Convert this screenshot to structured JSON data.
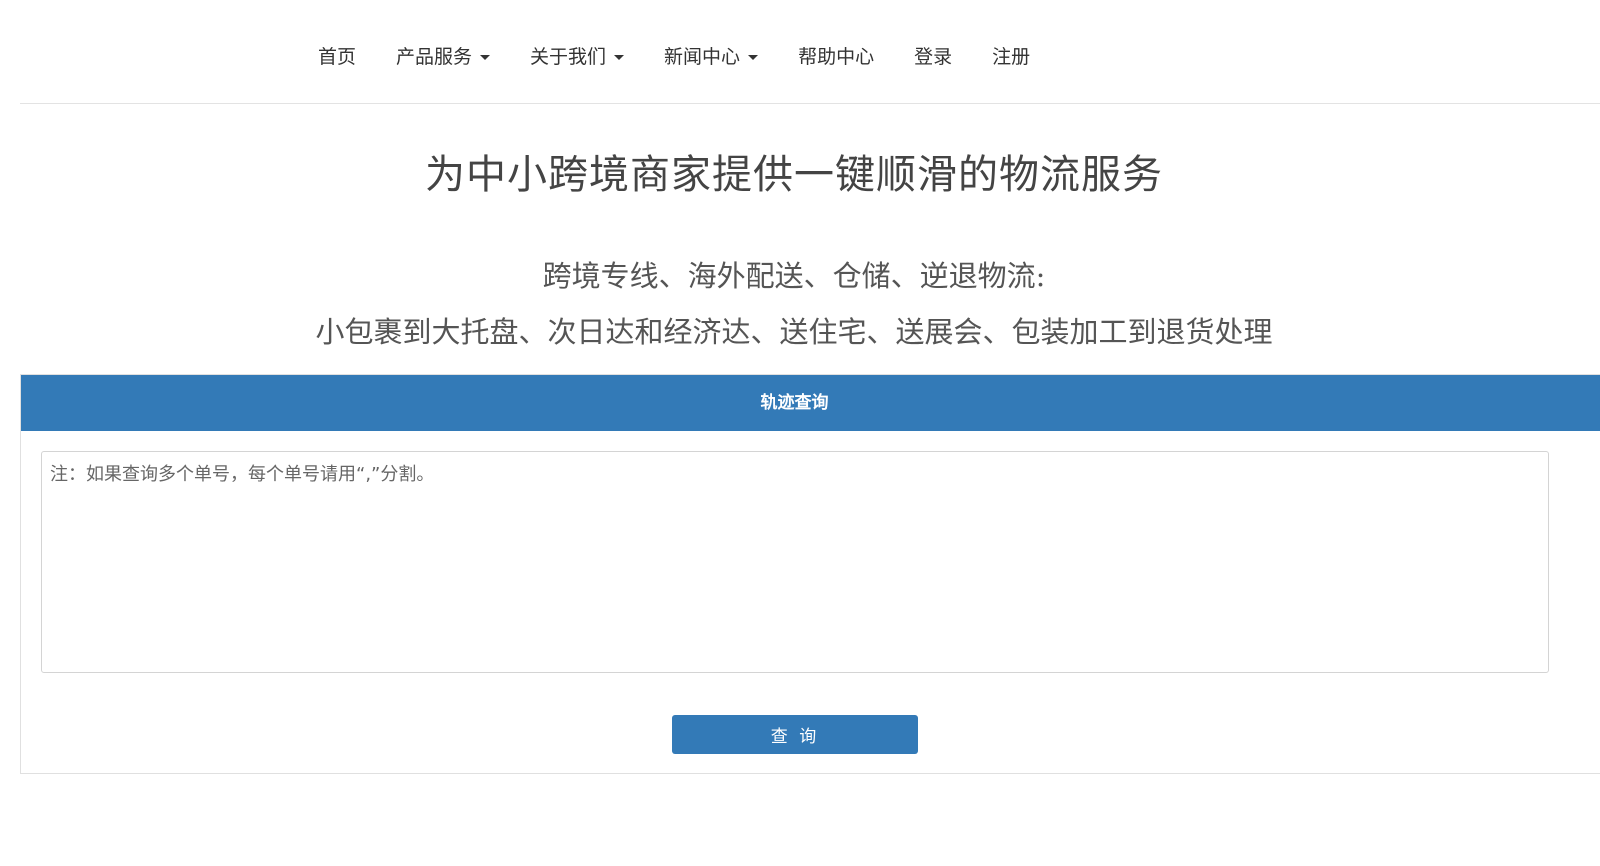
{
  "nav": {
    "items": [
      {
        "label": "首页",
        "dropdown": false
      },
      {
        "label": "产品服务",
        "dropdown": true
      },
      {
        "label": "关于我们",
        "dropdown": true
      },
      {
        "label": "新闻中心",
        "dropdown": true
      },
      {
        "label": "帮助中心",
        "dropdown": false
      },
      {
        "label": "登录",
        "dropdown": false
      },
      {
        "label": "注册",
        "dropdown": false
      }
    ]
  },
  "hero": {
    "title": "为中小跨境商家提供一键顺滑的物流服务",
    "line1": "跨境专线、海外配送、仓储、逆退物流:",
    "line2": "小包裹到大托盘、次日达和经济达、送住宅、送展会、包装加工到退货处理"
  },
  "tracking": {
    "heading": "轨迹查询",
    "placeholder": "注：如果查询多个单号，每个单号请用“,”分割。",
    "value": "",
    "button_label": "查 询"
  },
  "colors": {
    "primary": "#337ab7",
    "text": "#333333",
    "border": "#e0e0e0"
  }
}
